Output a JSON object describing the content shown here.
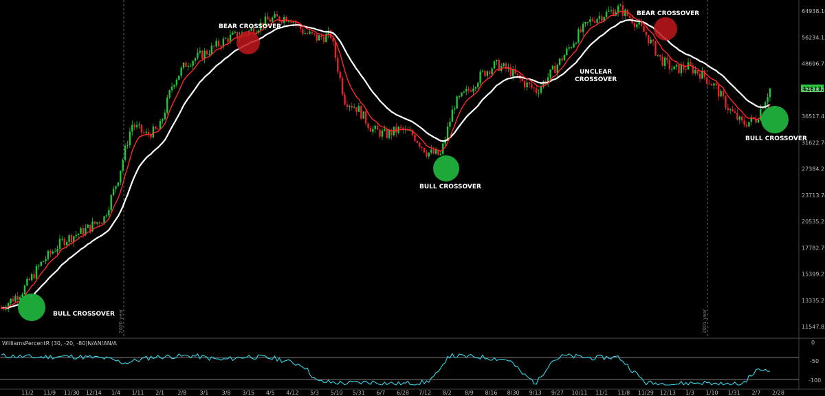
{
  "chart_data": {
    "type": "candlestick",
    "indicator_label": "WilliamsPercentR (30, -20, -80)N/AN/AN/A",
    "last_price": "42613.9",
    "y_ticks": [
      "64938.16",
      "56234.13",
      "48696.75",
      "42168.07",
      "36517.41",
      "31622.78",
      "27384.2",
      "23713.74",
      "20535.25",
      "17782.79",
      "15399.27",
      "13335.21",
      "11547.82"
    ],
    "x_ticks": [
      "11/2",
      "11/9",
      "11/30",
      "12/14",
      "1/4",
      "1/11",
      "2/1",
      "2/8",
      "3/1",
      "3/8",
      "3/15",
      "4/5",
      "4/12",
      "5/3",
      "5/10",
      "5/31",
      "6/7",
      "6/28",
      "7/12",
      "8/2",
      "8/9",
      "8/16",
      "8/30",
      "9/13",
      "9/27",
      "10/11",
      "11/1",
      "11/8",
      "11/29",
      "12/13",
      "1/3",
      "1/10",
      "1/31",
      "2/7",
      "2/28"
    ],
    "year_labels": [
      "2020 year",
      "2001 year"
    ],
    "indicator_ticks": [
      "0",
      "-50",
      "-100"
    ],
    "annotations": [
      {
        "text": "BEAR CROSSOVER",
        "color": "#c0171d"
      },
      {
        "text": "BEAR CROSSOVER",
        "color": "#c0171d"
      },
      {
        "text": "BULL CROSSOVER",
        "color": "#1fa83a"
      },
      {
        "text": "BULL CROSSOVER",
        "color": "#1fa83a"
      },
      {
        "text": "BULL CROSSOVER",
        "color": "#1fa83a"
      },
      {
        "text": "UNCLEAR",
        "color": null
      },
      {
        "text": "CROSSOVER",
        "color": null
      }
    ],
    "series": [
      {
        "name": "",
        "color": "#ff2a2a",
        "role": "fast-ma"
      },
      {
        "name": "",
        "color": "#ffffff",
        "role": "slow-ma"
      }
    ],
    "price_path": [
      [
        0,
        12800
      ],
      [
        3,
        14000
      ],
      [
        6,
        16500
      ],
      [
        9,
        18500
      ],
      [
        12,
        19500
      ],
      [
        15,
        21000
      ],
      [
        17,
        26000
      ],
      [
        19,
        35000
      ],
      [
        21,
        33000
      ],
      [
        23,
        34000
      ],
      [
        25,
        44000
      ],
      [
        27,
        49000
      ],
      [
        30,
        52000
      ],
      [
        33,
        56000
      ],
      [
        36,
        58000
      ],
      [
        39,
        62000
      ],
      [
        42,
        63000
      ],
      [
        44,
        58000
      ],
      [
        46,
        56000
      ],
      [
        48,
        57000
      ],
      [
        50,
        40000
      ],
      [
        52,
        38000
      ],
      [
        54,
        34000
      ],
      [
        56,
        33000
      ],
      [
        58,
        34000
      ],
      [
        60,
        33000
      ],
      [
        62,
        30000
      ],
      [
        64,
        29500
      ],
      [
        66,
        39000
      ],
      [
        68,
        42000
      ],
      [
        70,
        46000
      ],
      [
        72,
        48500
      ],
      [
        74,
        47000
      ],
      [
        76,
        44000
      ],
      [
        78,
        42000
      ],
      [
        80,
        46000
      ],
      [
        82,
        51000
      ],
      [
        84,
        57000
      ],
      [
        86,
        62000
      ],
      [
        88,
        64000
      ],
      [
        90,
        66000
      ],
      [
        92,
        62000
      ],
      [
        94,
        57000
      ],
      [
        96,
        50000
      ],
      [
        98,
        47000
      ],
      [
        100,
        48000
      ],
      [
        102,
        46000
      ],
      [
        104,
        43000
      ],
      [
        106,
        38000
      ],
      [
        108,
        35000
      ],
      [
        110,
        36000
      ],
      [
        112,
        42500
      ]
    ],
    "williams_path": [
      [
        0,
        -18
      ],
      [
        5,
        -22
      ],
      [
        10,
        -20
      ],
      [
        15,
        -25
      ],
      [
        18,
        -38
      ],
      [
        22,
        -22
      ],
      [
        28,
        -18
      ],
      [
        32,
        -30
      ],
      [
        36,
        -20
      ],
      [
        40,
        -26
      ],
      [
        44,
        -45
      ],
      [
        46,
        -90
      ],
      [
        50,
        -95
      ],
      [
        54,
        -92
      ],
      [
        58,
        -97
      ],
      [
        62,
        -92
      ],
      [
        64,
        -60
      ],
      [
        65,
        -18
      ],
      [
        70,
        -22
      ],
      [
        74,
        -30
      ],
      [
        76,
        -70
      ],
      [
        78,
        -95
      ],
      [
        80,
        -35
      ],
      [
        82,
        -18
      ],
      [
        86,
        -24
      ],
      [
        90,
        -22
      ],
      [
        92,
        -60
      ],
      [
        94,
        -95
      ],
      [
        98,
        -97
      ],
      [
        102,
        -93
      ],
      [
        106,
        -100
      ],
      [
        108,
        -96
      ],
      [
        110,
        -60
      ],
      [
        112,
        -55
      ]
    ],
    "ylim": [
      11000,
      68000
    ],
    "indicator_ylim": [
      -100,
      0
    ]
  }
}
